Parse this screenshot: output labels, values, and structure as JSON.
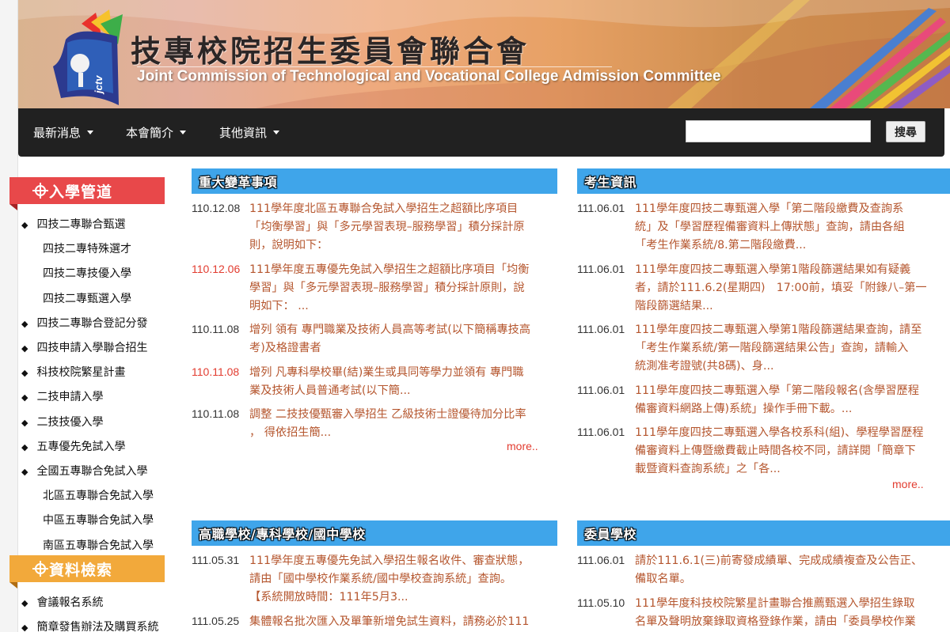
{
  "header": {
    "title_zh": "技專校院招生委員會聯合會",
    "title_en": "Joint Commission of Technological and Vocational College Admission Committee",
    "logo_text": "jctv"
  },
  "nav": {
    "items": [
      {
        "label": "最新消息"
      },
      {
        "label": "本會簡介"
      },
      {
        "label": "其他資訊"
      }
    ],
    "search_placeholder": "",
    "search_button": "搜尋"
  },
  "sidebar": {
    "section1": {
      "title": "入學管道",
      "color": "#e8484a"
    },
    "section1_items": [
      {
        "label": "四技二專聯合甄選",
        "bullet": true
      },
      {
        "label": "四技二專特殊選才",
        "bullet": false
      },
      {
        "label": "四技二專技優入學",
        "bullet": false
      },
      {
        "label": "四技二專甄選入學",
        "bullet": false
      },
      {
        "label": "四技二專聯合登記分發",
        "bullet": true
      },
      {
        "label": "四技申請入學聯合招生",
        "bullet": true
      },
      {
        "label": "科技校院繁星計畫",
        "bullet": true
      },
      {
        "label": "二技申請入學",
        "bullet": true
      },
      {
        "label": "二技技優入學",
        "bullet": true
      },
      {
        "label": "五專優先免試入學",
        "bullet": true
      },
      {
        "label": "全國五專聯合免試入學",
        "bullet": true
      },
      {
        "label": "北區五專聯合免試入學",
        "bullet": false
      },
      {
        "label": "中區五專聯合免試入學",
        "bullet": false
      },
      {
        "label": "南區五專聯合免試入學",
        "bullet": false
      }
    ],
    "section2": {
      "title": "資料檢索",
      "color": "#f2a93b"
    },
    "section2_items": [
      {
        "label": "會議報名系統",
        "bullet": true
      },
      {
        "label": "簡章發售辦法及購買系統",
        "bullet": true
      }
    ],
    "bullet_char": "◆"
  },
  "panels": {
    "reform": {
      "title": "重大變革事項",
      "items": [
        {
          "date": "110.12.08",
          "red": false,
          "lines": [
            "111學年度北區五專聯合免試入學招生之超額比序項目",
            "「均衡學習」與「多元學習表現–服務學習」積分採計原",
            "則，說明如下："
          ]
        },
        {
          "date": "110.12.06",
          "red": true,
          "lines": [
            "111學年度五專優先免試入學招生之超額比序項目「均衡",
            "學習」與「多元學習表現–服務學習」積分採計原則，說",
            "明如下： ..."
          ]
        },
        {
          "date": "110.11.08",
          "red": false,
          "lines": [
            "增列 領有 專門職業及技術人員高等考試(以下簡稱專技高",
            "考)及格證書者"
          ]
        },
        {
          "date": "110.11.08",
          "red": true,
          "lines": [
            "增列 凡專科學校畢(結)業生或具同等學力並領有 專門職",
            "業及技術人員普通考試(以下簡..."
          ]
        },
        {
          "date": "110.11.08",
          "red": false,
          "lines": [
            "調整 二技技優甄審入學招生 乙級技術士證優待加分比率",
            "， 得依招生簡..."
          ]
        }
      ],
      "more": "more.."
    },
    "examinee": {
      "title": "考生資訊",
      "items": [
        {
          "date": "111.06.01",
          "red": false,
          "lines": [
            "111學年度四技二專甄選入學「第二階段繳費及查詢系",
            "統」及「學習歷程備審資料上傳狀態」查詢，請由各組",
            "「考生作業系統/8.第二階段繳費..."
          ]
        },
        {
          "date": "111.06.01",
          "red": false,
          "lines": [
            "111學年度四技二專甄選入學第1階段篩選結果如有疑義",
            "者，請於111.6.2(星期四)　17:00前，填妥「附錄八–第一",
            "階段篩選結果..."
          ]
        },
        {
          "date": "111.06.01",
          "red": false,
          "lines": [
            "111學年度四技二專甄選入學第1階段篩選結果查詢，請至",
            "「考生作業系統/第一階段篩選結果公告」查詢，請輸入",
            "統測准考證號(共8碼)、身..."
          ]
        },
        {
          "date": "111.06.01",
          "red": false,
          "lines": [
            "111學年度四技二專甄選入學「第二階段報名(含學習歷程",
            "備審資料網路上傳)系統」操作手冊下載。..."
          ]
        },
        {
          "date": "111.06.01",
          "red": false,
          "lines": [
            "111學年度四技二專甄選入學各校系科(組)、學程學習歷程",
            "備審資料上傳暨繳費截止時間各校不同，請詳閱「簡章下",
            "載暨資料查詢系統」之「各..."
          ]
        }
      ],
      "more": "more.."
    },
    "schools": {
      "title": "高職學校/專科學校/國中學校",
      "items": [
        {
          "date": "111.05.31",
          "red": false,
          "lines": [
            "111學年度五專優先免試入學招生報名收件、審查狀態，",
            "請由「國中學校作業系統/國中學校查詢系統」查詢。",
            "【系統開放時間：111年5月3..."
          ]
        },
        {
          "date": "111.05.25",
          "red": false,
          "lines": [
            "集體報名批次匯入及單筆新增免試生資料，請務必於111"
          ]
        }
      ]
    },
    "committee": {
      "title": "委員學校",
      "items": [
        {
          "date": "111.06.01",
          "red": false,
          "lines": [
            "請於111.6.1(三)前寄發成績單、完成成績複查及公告正、",
            "備取名單。"
          ]
        },
        {
          "date": "111.05.10",
          "red": false,
          "lines": [
            "111學年度科技校院繁星計畫聯合推薦甄選入學招生錄取",
            "名單及聲明放棄錄取資格登錄作業，請由「委員學校作業"
          ]
        }
      ]
    }
  },
  "colors": {
    "navbar": "#212121",
    "panel_header": "#3fa5ea",
    "link": "#b5562e",
    "date_red": "#e23c30"
  }
}
